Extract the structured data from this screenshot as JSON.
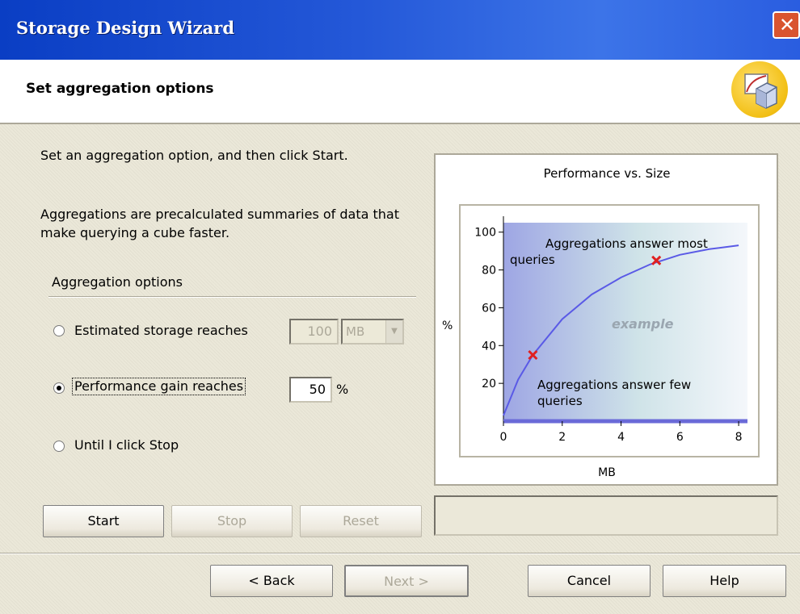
{
  "window": {
    "title": "Storage Design Wizard"
  },
  "header": {
    "subtitle": "Set aggregation options",
    "icon": "wizard-cube-chart-icon"
  },
  "intro": {
    "line1": "Set an aggregation option, and then click Start.",
    "line2a": "Aggregations are precalculated summaries of data that",
    "line2b": "make querying a cube faster."
  },
  "options": {
    "group_label": "Aggregation options",
    "estimated": {
      "label": "Estimated storage reaches",
      "value": "100",
      "unit": "MB",
      "selected": false
    },
    "performance": {
      "label": "Performance gain reaches",
      "value": "50",
      "unit": "%",
      "selected": true
    },
    "until_stop": {
      "label": "Until I click Stop",
      "selected": false
    }
  },
  "buttons": {
    "start": "Start",
    "stop": "Stop",
    "reset": "Reset",
    "back": "< Back",
    "next": "Next >",
    "cancel": "Cancel",
    "help": "Help"
  },
  "chart_data": {
    "type": "line",
    "title": "Performance vs. Size",
    "xlabel": "MB",
    "ylabel": "%",
    "xlim": [
      0,
      8.3
    ],
    "ylim": [
      0,
      105
    ],
    "xticks": [
      "0",
      "2",
      "4",
      "6",
      "8"
    ],
    "yticks": [
      "20",
      "40",
      "60",
      "80",
      "100"
    ],
    "series": [
      {
        "x": [
          0,
          0.5,
          1,
          2,
          3,
          4,
          5,
          6,
          7,
          8
        ],
        "values": [
          3,
          22,
          35,
          54,
          67,
          76,
          83,
          88,
          91,
          93
        ]
      }
    ],
    "markers": [
      {
        "x": 1,
        "y": 35
      },
      {
        "x": 5.2,
        "y": 85
      }
    ],
    "annotations": {
      "top_a": "Aggregations answer most",
      "top_b": "queries",
      "bottom_a": "Aggregations answer few",
      "bottom_b": "queries",
      "watermark": "example"
    },
    "grid": false,
    "colors": {
      "curve": "#5a5ae6",
      "marker": "#e02020",
      "background_left": "#9ea6e4",
      "background_right": "#f4f7fb"
    }
  }
}
